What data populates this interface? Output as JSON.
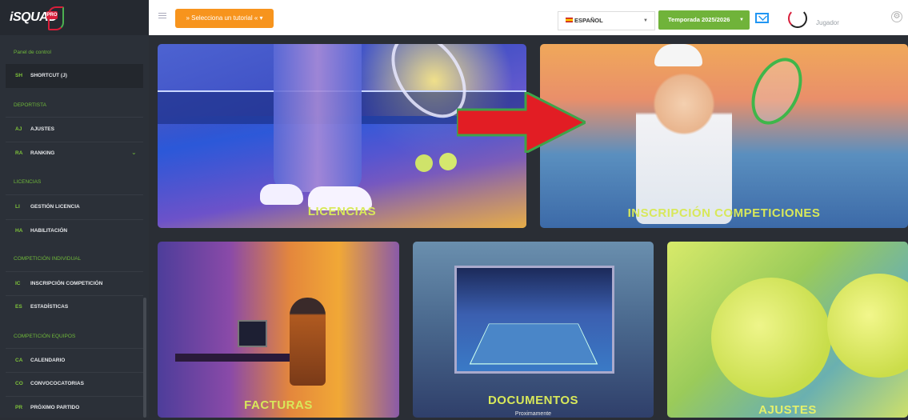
{
  "sidebar": {
    "logo": "iSQUAD",
    "logo_badge": "PRO",
    "panel": "Panel de control",
    "sections": {
      "deportista": "DEPORTISTA",
      "licencias": "LICENCIAS",
      "individual": "COMPETICIÓN INDIVIDUAL",
      "equipos": "COMPETICIÓN EQUIPOS"
    },
    "items": [
      {
        "abbr": "SH",
        "label": "SHORTCUT (J)"
      },
      {
        "abbr": "AJ",
        "label": "AJUSTES"
      },
      {
        "abbr": "RA",
        "label": "RANKING"
      },
      {
        "abbr": "LI",
        "label": "GESTIÓN LICENCIA"
      },
      {
        "abbr": "HA",
        "label": "HABILITACIÓN"
      },
      {
        "abbr": "IC",
        "label": "INSCRIPCIÓN COMPETICIÓN"
      },
      {
        "abbr": "ES",
        "label": "ESTADÍSTICAS"
      },
      {
        "abbr": "CA",
        "label": "CALENDARIO"
      },
      {
        "abbr": "CO",
        "label": "CONVOCOCATORIAS"
      },
      {
        "abbr": "PR",
        "label": "PRÓXIMO PARTIDO"
      }
    ]
  },
  "topbar": {
    "tutorial": "» Selecciona un tutorial « ▾",
    "language": "ESPAÑOL",
    "season": "Temporada 2025/2026",
    "user": "Jugador"
  },
  "cards": {
    "licencias": "LICENCIAS",
    "inscripcion": "INSCRIPCIÓN COMPETICIONES",
    "facturas": "FACTURAS",
    "documentos": "DOCUMENTOS",
    "documentos_sub": "Proximamente",
    "ajustes": "AJUSTES"
  },
  "icons": {
    "menu": "hamburger-icon",
    "mail": "mail-icon",
    "settings": "gear-icon",
    "flag": "spain-flag-icon",
    "chevron": "chevron-down-icon",
    "arrow": "red-arrow-annotation"
  },
  "colors": {
    "sidebar_bg": "#2b3038",
    "accent_green": "#70b33a",
    "tutorial_orange": "#f7941d",
    "card_title": "#d8e85a",
    "arrow_red": "#e21d24"
  }
}
